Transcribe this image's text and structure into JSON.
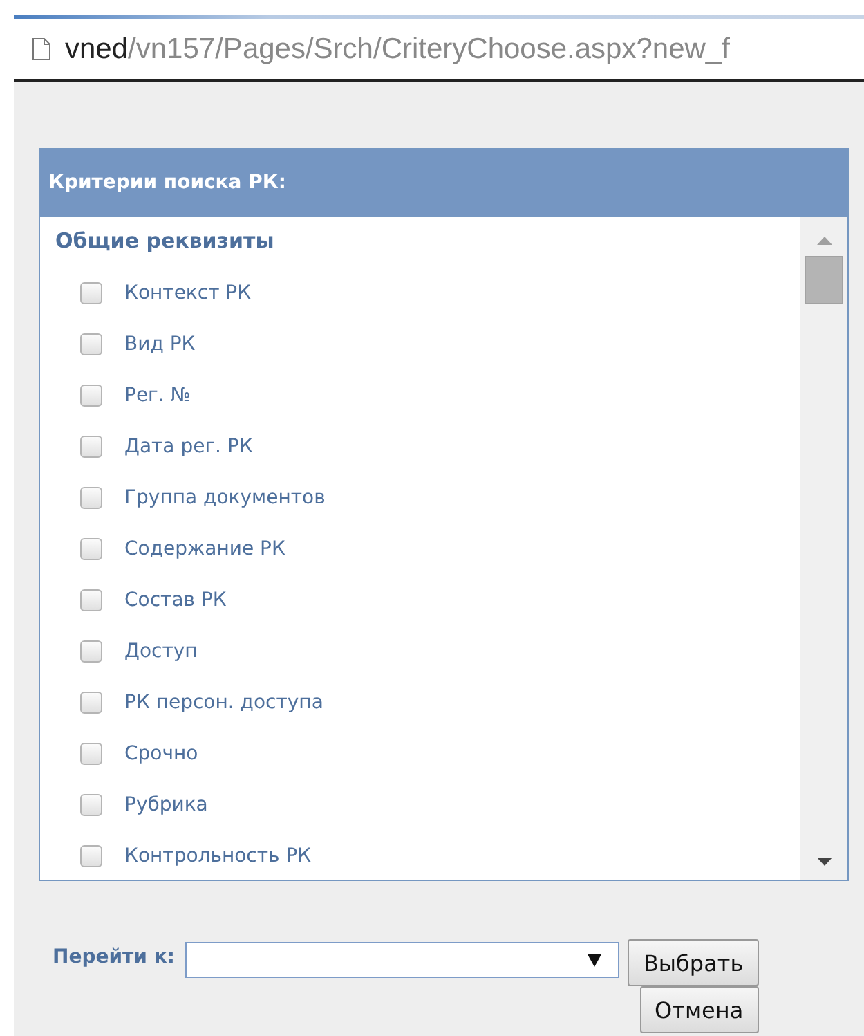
{
  "address_bar": {
    "host": "vned",
    "path": "/vn157/Pages/Srch/CriteryChoose.aspx?new_f"
  },
  "panel": {
    "title": "Критерии поиска РК:",
    "group": "Общие реквизиты",
    "items": [
      {
        "label": "Контекст РК",
        "checked": false
      },
      {
        "label": "Вид РК",
        "checked": false
      },
      {
        "label": "Рег. №",
        "checked": false
      },
      {
        "label": "Дата рег. РК",
        "checked": false
      },
      {
        "label": "Группа документов",
        "checked": false
      },
      {
        "label": "Содержание РК",
        "checked": false
      },
      {
        "label": "Состав РК",
        "checked": false
      },
      {
        "label": "Доступ",
        "checked": false
      },
      {
        "label": "РК персон. доступа",
        "checked": false
      },
      {
        "label": "Срочно",
        "checked": false
      },
      {
        "label": "Рубрика",
        "checked": false
      },
      {
        "label": "Контрольность РК",
        "checked": false
      }
    ]
  },
  "goto": {
    "label": "Перейти к:"
  },
  "buttons": [
    "Выбрать",
    "Отмена"
  ]
}
